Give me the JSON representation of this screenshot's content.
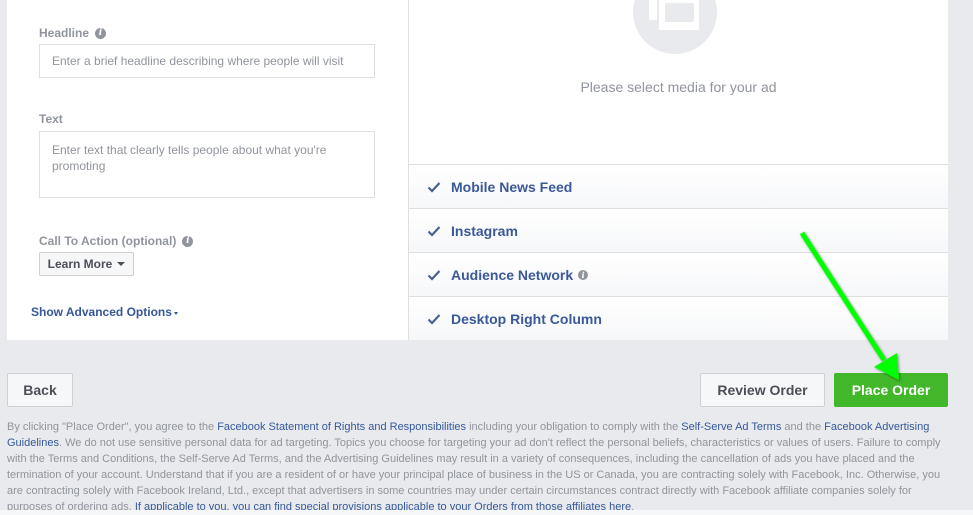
{
  "form": {
    "headline": {
      "label": "Headline",
      "placeholder": "Enter a brief headline describing where people will visit",
      "value": ""
    },
    "text": {
      "label": "Text",
      "placeholder": "Enter text that clearly tells people about what you're promoting",
      "value": ""
    },
    "call_to_action": {
      "label": "Call To Action (optional)",
      "selected": "Learn More"
    },
    "advanced_options_link": "Show Advanced Options"
  },
  "preview": {
    "media_message": "Please select media for your ad",
    "placements": [
      {
        "label": "Mobile News Feed",
        "checked": true,
        "info": false
      },
      {
        "label": "Instagram",
        "checked": true,
        "info": false
      },
      {
        "label": "Audience Network",
        "checked": true,
        "info": true
      },
      {
        "label": "Desktop Right Column",
        "checked": true,
        "info": false
      }
    ]
  },
  "footer": {
    "back_label": "Back",
    "review_label": "Review Order",
    "place_label": "Place Order"
  },
  "legal": {
    "t1": "By clicking \"Place Order\", you agree to the ",
    "link_sorr": "Facebook Statement of Rights and Responsibilities",
    "t2": " including your obligation to comply with the ",
    "link_ssat": "Self-Serve Ad Terms",
    "t3": " and the ",
    "link_guidelines": "Facebook Advertising Guidelines",
    "t4": ". We do not use sensitive personal data for ad targeting. Topics you choose for targeting your ad don't reflect the personal beliefs, characteristics or values of users. Failure to comply with the Terms and Conditions, the Self-Serve Ad Terms, and the Advertising Guidelines may result in a variety of consequences, including the cancellation of ads you have placed and the termination of your account. Understand that if you are a resident of or have your principal place of business in the US or Canada, you are contracting solely with Facebook, Inc. Otherwise, you are contracting solely with Facebook Ireland, Ltd., except that advertisers in some countries may under certain circumstances contract directly with Facebook affiliate companies solely for purposes of ordering ads. ",
    "link_provisions": "If applicable to you, you can find special provisions applicable to your Orders from those affiliates here",
    "t5": "."
  },
  "colors": {
    "accent_green": "#42b72a",
    "link_blue": "#365899",
    "placement_blue": "#3b5998",
    "annotation_arrow": "#00ff00"
  }
}
